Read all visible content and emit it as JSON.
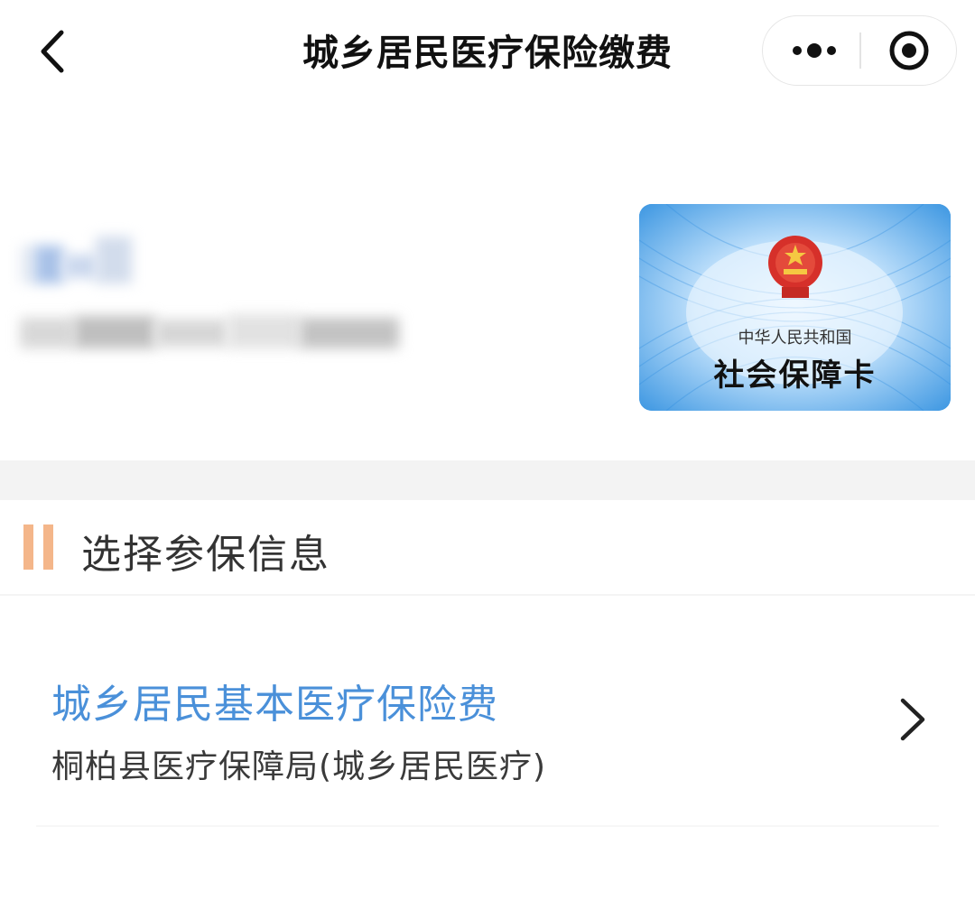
{
  "navbar": {
    "title": "城乡居民医疗保险缴费",
    "back_icon": "chevron-left-icon",
    "more_icon": "more-dots-icon",
    "close_icon": "target-circle-icon"
  },
  "card": {
    "country_text": "中华人民共和国",
    "card_title": "社会保障卡",
    "colors": {
      "primary": "#4ba3e6",
      "emblem": "#d6302a"
    }
  },
  "section": {
    "title": "选择参保信息",
    "accent_color": "#f4b68a"
  },
  "items": [
    {
      "title": "城乡居民基本医疗保险费",
      "subtitle": "桐柏县医疗保障局(城乡居民医疗)",
      "title_color": "#4a90d9"
    }
  ]
}
